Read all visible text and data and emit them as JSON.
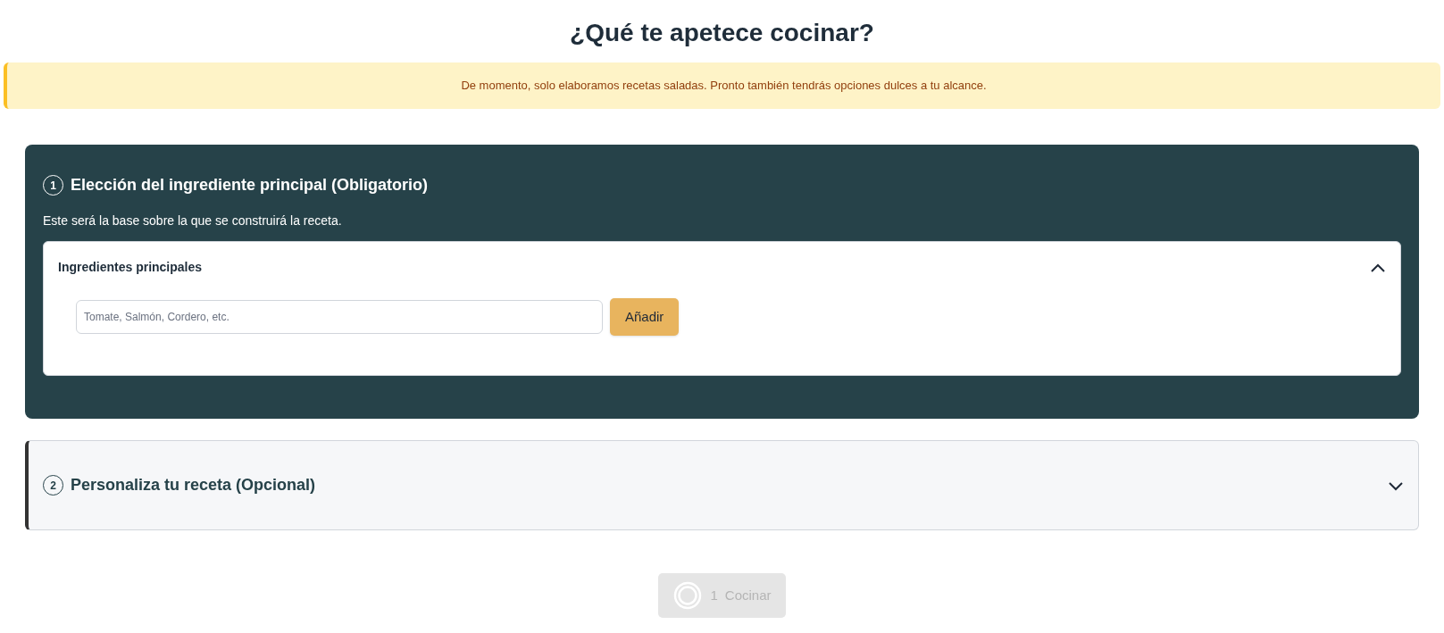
{
  "title": "¿Qué te apetece cocinar?",
  "notice": "De momento, solo elaboramos recetas saladas. Pronto también tendrás opciones dulces a tu alcance.",
  "steps": [
    {
      "number": "1",
      "title": "Elección del ingrediente principal (Obligatorio)",
      "expanded": true,
      "description": "Este será la base sobre la que se construirá la receta.",
      "panel": {
        "title": "Ingredientes principales",
        "expanded": true,
        "placeholder": "Tomate, Salmón, Cordero, etc.",
        "button": "Añadir"
      }
    },
    {
      "number": "2",
      "title": "Personaliza tu receta (Opcional)",
      "expanded": false
    }
  ],
  "cook_button": {
    "count": "1",
    "label": "Cocinar",
    "disabled": true
  }
}
